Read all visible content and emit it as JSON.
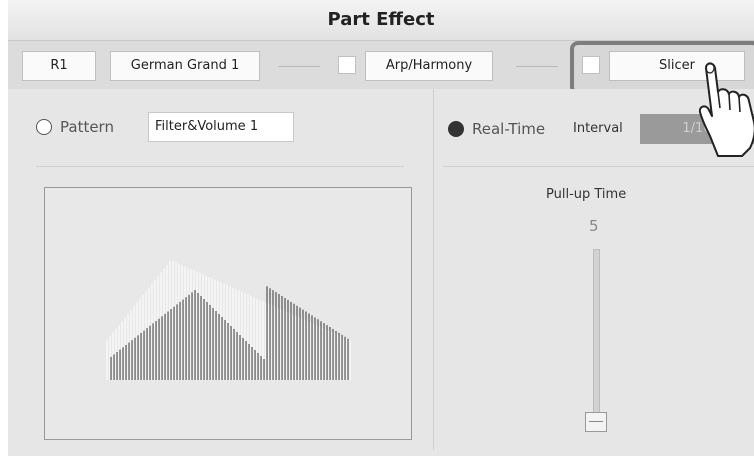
{
  "window": {
    "title": "Part Effect"
  },
  "toolbar": {
    "part": "R1",
    "voice": "German Grand 1",
    "arp_harmony": "Arp/Harmony",
    "slicer": "Slicer"
  },
  "left_panel": {
    "pattern_label": "Pattern",
    "pattern_value": "Filter&Volume 1",
    "pattern_selected": false
  },
  "right_panel": {
    "mode_label": "Real-Time",
    "mode_selected": true,
    "interval_label": "Interval",
    "interval_value": "1/16",
    "pullup_label": "Pull-up Time",
    "pullup_value": "5"
  },
  "colors": {
    "panel": "#e6e6e6",
    "button": "#fafafa",
    "highlight_frame": "#7d7d7d",
    "disabled_field": "#9a9a9a"
  },
  "icons": [
    "radio-off-icon",
    "radio-on-icon",
    "pointing-hand-icon"
  ]
}
